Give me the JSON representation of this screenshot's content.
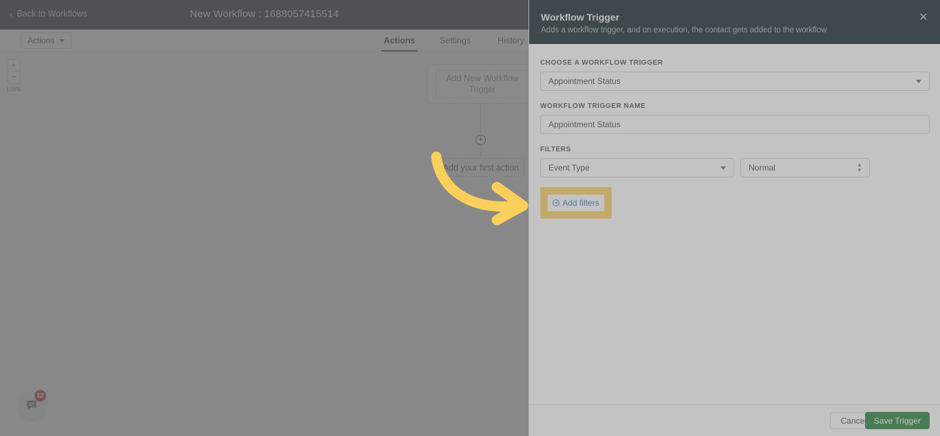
{
  "topbar": {
    "back_label": "Back to Workflows",
    "back_icon": "chevron-left-icon",
    "workflow_title": "New Workflow : 1688057415514"
  },
  "subbar": {
    "actions_button": "Actions",
    "tabs": [
      {
        "label": "Actions",
        "active": true
      },
      {
        "label": "Settings",
        "active": false
      },
      {
        "label": "History",
        "active": false
      }
    ]
  },
  "canvas": {
    "zoom": {
      "plus": "+",
      "minus": "−",
      "percent": "100%"
    },
    "trigger_card_label": "Add New Workflow Trigger",
    "plus_node": "+",
    "first_action_label": "Add your first action",
    "chat": {
      "icon": "chat-bubble-icon",
      "badge": "12"
    }
  },
  "panel": {
    "title": "Workflow Trigger",
    "subtitle": "Adds a workflow trigger, and on execution, the contact gets added to the workflow",
    "close_icon": "close-icon",
    "trigger_label": "CHOOSE A WORKFLOW TRIGGER",
    "trigger_value": "Appointment Status",
    "name_label": "WORKFLOW TRIGGER NAME",
    "name_value": "Appointment Status",
    "filters_label": "FILTERS",
    "filter_field_value": "Event Type",
    "filter_value_value": "Normal",
    "add_filters_label": "Add filters",
    "add_filters_icon": "plus-circle-icon",
    "cancel_label": "Cancel",
    "save_label": "Save Trigger"
  },
  "annotation": {
    "arrow_color": "#FBD05A",
    "highlight_color": "#FBD05A"
  },
  "colors": {
    "header_dark": "#06181f",
    "accent_green": "#1a7a2e",
    "link_blue": "#2e6fb7",
    "badge_red": "#c2201d"
  }
}
